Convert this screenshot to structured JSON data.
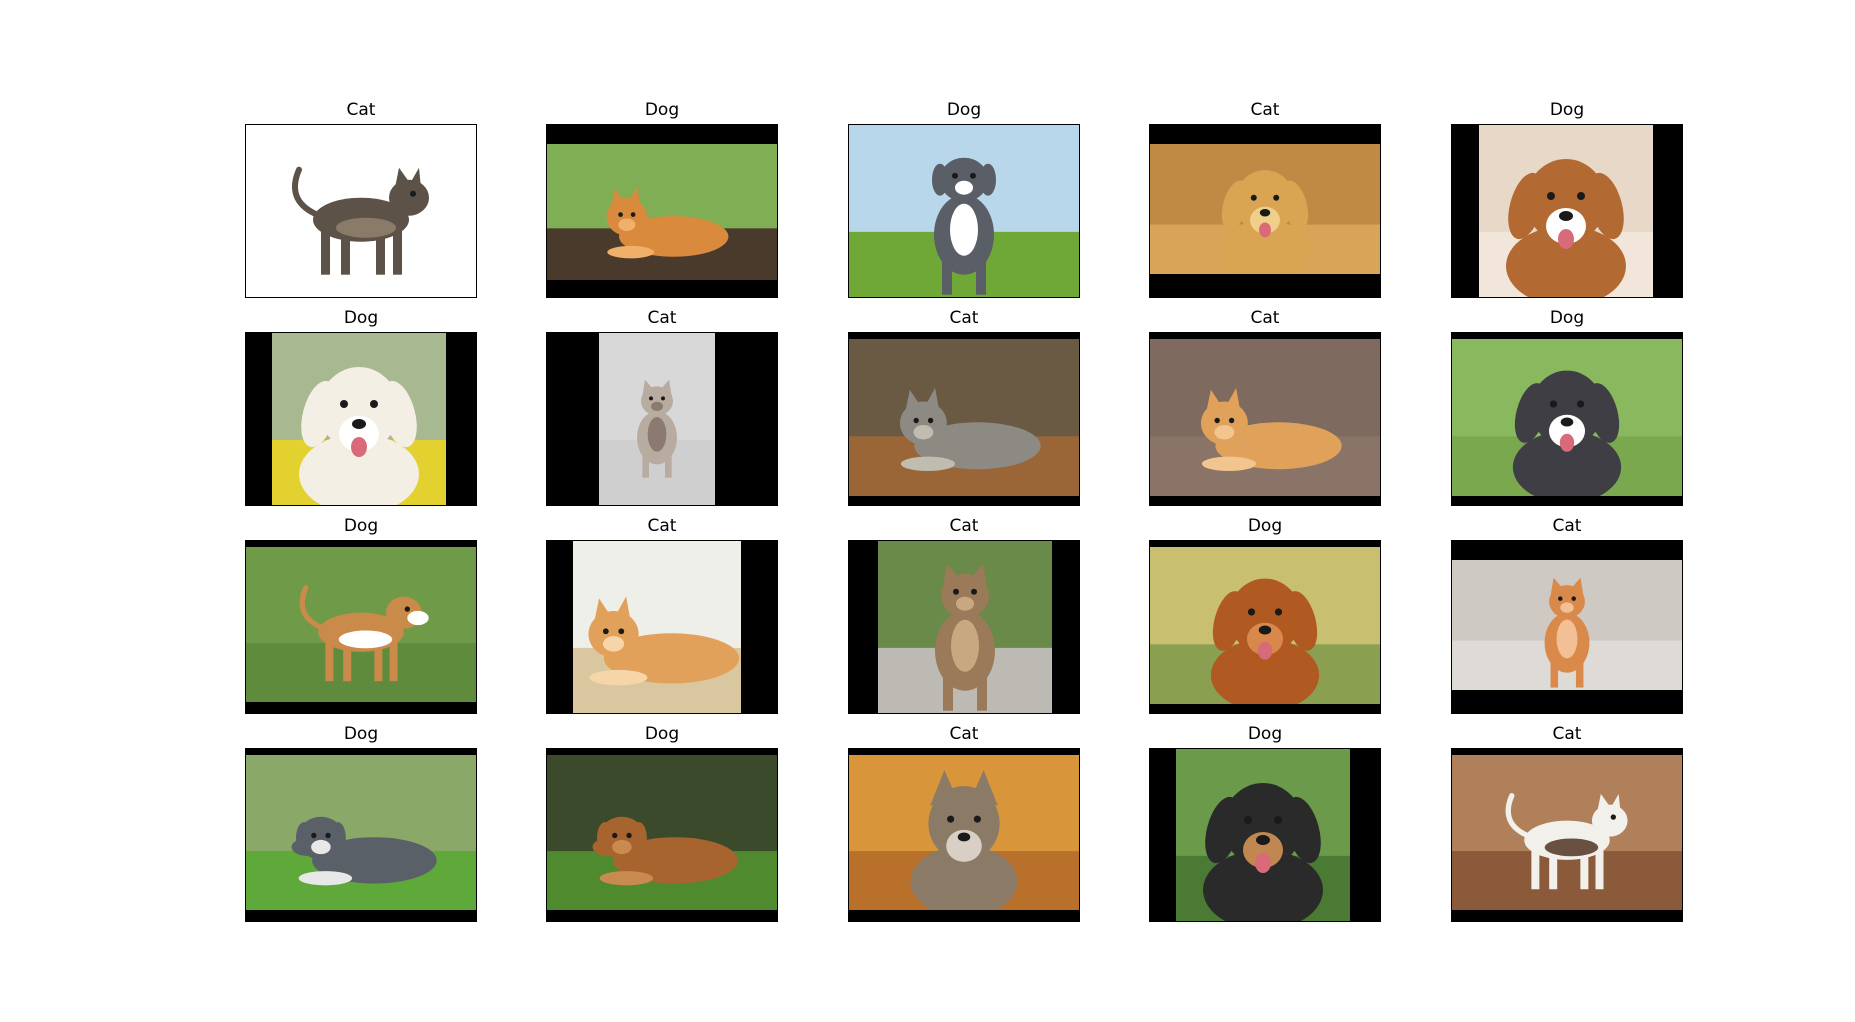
{
  "figure": {
    "images": [
      {
        "label": "Cat",
        "subject": "cat"
      },
      {
        "label": "Dog",
        "subject": "cat"
      },
      {
        "label": "Dog",
        "subject": "dog"
      },
      {
        "label": "Cat",
        "subject": "dog"
      },
      {
        "label": "Dog",
        "subject": "dog"
      },
      {
        "label": "Dog",
        "subject": "dog"
      },
      {
        "label": "Cat",
        "subject": "cat"
      },
      {
        "label": "Cat",
        "subject": "cat"
      },
      {
        "label": "Cat",
        "subject": "cat"
      },
      {
        "label": "Dog",
        "subject": "dog"
      },
      {
        "label": "Dog",
        "subject": "dog"
      },
      {
        "label": "Cat",
        "subject": "cat"
      },
      {
        "label": "Cat",
        "subject": "cat"
      },
      {
        "label": "Dog",
        "subject": "dog"
      },
      {
        "label": "Cat",
        "subject": "cat"
      },
      {
        "label": "Dog",
        "subject": "dog"
      },
      {
        "label": "Dog",
        "subject": "dog"
      },
      {
        "label": "Cat",
        "subject": "cat"
      },
      {
        "label": "Dog",
        "subject": "dog"
      },
      {
        "label": "Cat",
        "subject": "cat"
      }
    ]
  }
}
